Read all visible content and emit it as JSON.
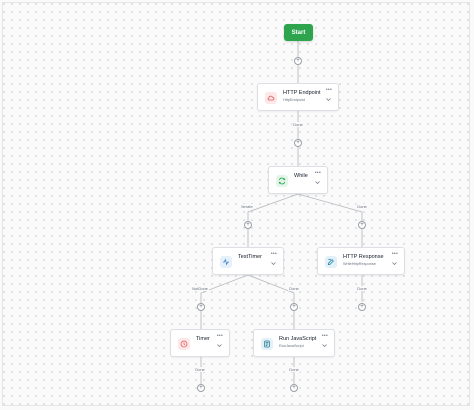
{
  "flow": {
    "start_label": "Start",
    "more_glyph": "•••",
    "plus_glyph": "+",
    "nodes": [
      {
        "title": "HTTP Endpoint",
        "subtitle": "HttpEndpoint",
        "icon": "cloud-icon",
        "icon_color": "#e0575b",
        "icon_bg": "#fde8e8"
      },
      {
        "title": "While",
        "subtitle": "",
        "icon": "loop-icon",
        "icon_color": "#2ea44f",
        "icon_bg": "#e3f5e9"
      },
      {
        "title": "TestTimer",
        "subtitle": "",
        "icon": "activity-icon",
        "icon_color": "#3b82c4",
        "icon_bg": "#e6f0fa"
      },
      {
        "title": "HTTP Response",
        "subtitle": "WriteHttpResponse",
        "icon": "edit-icon",
        "icon_color": "#1e7fa8",
        "icon_bg": "#e2f1f8"
      },
      {
        "title": "Timer",
        "subtitle": "",
        "icon": "clock-icon",
        "icon_color": "#e0575b",
        "icon_bg": "#fde8e8"
      },
      {
        "title": "Run JavaScript",
        "subtitle": "RunJavaScript",
        "icon": "script-icon",
        "icon_color": "#1e6f8f",
        "icon_bg": "#e2f1f8"
      }
    ],
    "edge_labels": [
      "Done",
      "Iterate",
      "Done",
      "NotDone",
      "Done",
      "Done",
      "Done",
      "Done"
    ]
  }
}
